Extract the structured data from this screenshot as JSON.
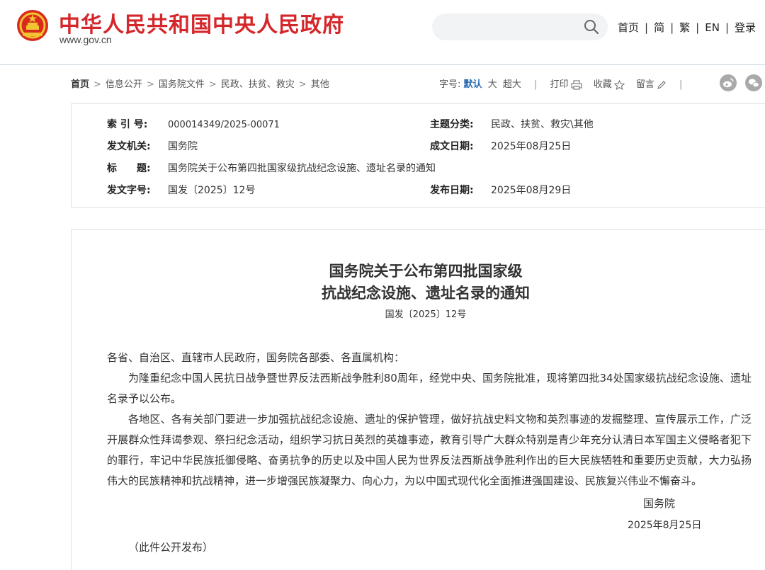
{
  "header": {
    "site_title": "中华人民共和国中央人民政府",
    "site_url": "www.gov.cn",
    "search_placeholder": "",
    "links": [
      "首页",
      "简",
      "繁",
      "EN",
      "登录"
    ]
  },
  "breadcrumb": {
    "items": [
      "首页",
      "信息公开",
      "国务院文件",
      "民政、扶贫、救灾",
      "其他"
    ]
  },
  "tools": {
    "font_size_label": "字号:",
    "font_sizes": [
      "默认",
      "大",
      "超大"
    ],
    "print": "打印",
    "favorite": "收藏",
    "comment": "留言"
  },
  "meta": {
    "index_key": "索 引 号:",
    "index_val": "000014349/2025-00071",
    "topic_key": "主题分类:",
    "topic_val": "民政、扶贫、救灾\\其他",
    "issuer_key": "发文机关:",
    "issuer_val": "国务院",
    "written_key": "成文日期:",
    "written_val": "2025年08月25日",
    "title_key": "标　　题:",
    "title_val": "国务院关于公布第四批国家级抗战纪念设施、遗址名录的通知",
    "docno_key": "发文字号:",
    "docno_val": "国发〔2025〕12号",
    "published_key": "发布日期:",
    "published_val": "2025年08月29日"
  },
  "article": {
    "title_line1": "国务院关于公布第四批国家级",
    "title_line2": "抗战纪念设施、遗址名录的通知",
    "doc_number": "国发〔2025〕12号",
    "salutation": "各省、自治区、直辖市人民政府，国务院各部委、各直属机构：",
    "paragraph1": "为隆重纪念中国人民抗日战争暨世界反法西斯战争胜利80周年，经党中央、国务院批准，现将第四批34处国家级抗战纪念设施、遗址名录予以公布。",
    "paragraph2": "各地区、各有关部门要进一步加强抗战纪念设施、遗址的保护管理，做好抗战史料文物和英烈事迹的发掘整理、宣传展示工作，广泛开展群众性拜谒参观、祭扫纪念活动，组织学习抗日英烈的英雄事迹，教育引导广大群众特别是青少年充分认清日本军国主义侵略者犯下的罪行，牢记中华民族抵御侵略、奋勇抗争的历史以及中国人民为世界反法西斯战争胜利作出的巨大民族牺牲和重要历史贡献，大力弘扬伟大的民族精神和抗战精神，进一步增强民族凝聚力、向心力，为以中国式现代化全面推进强国建设、民族复兴伟业不懈奋斗。",
    "signature": "国务院",
    "date": "2025年8月25日",
    "footnote": "（此件公开发布）"
  },
  "colors": {
    "brand_red": "#d4272b",
    "link_blue": "#2b6bb2"
  }
}
